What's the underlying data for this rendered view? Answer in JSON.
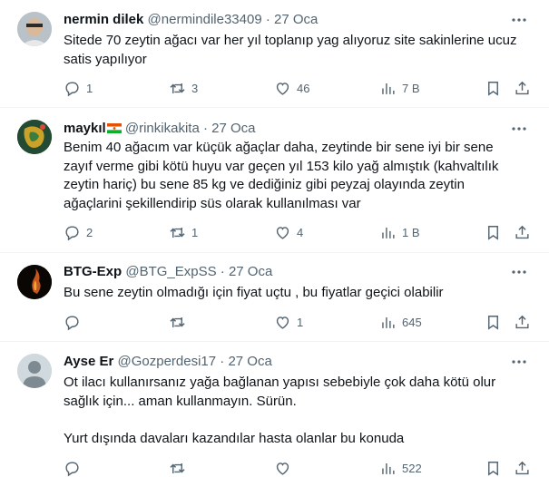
{
  "tweets": [
    {
      "name": "nermin dilek",
      "handle": "@nermindile33409",
      "separator": "·",
      "date": "27 Oca",
      "text": "Sitede 70 zeytin ağacı var her yıl toplanıp yag alıyoruz site sakinlerine ucuz\nsatis yapılıyor",
      "replies": "1",
      "retweets": "3",
      "likes": "46",
      "views": "7 B"
    },
    {
      "name": "maykıl",
      "handle": "@rinkikakita",
      "separator": "·",
      "date": "27 Oca",
      "text": "Benim 40 ağacım var küçük ağaçlar daha, zeytinde bir sene iyi bir sene\nzayıf verme gibi kötü huyu var geçen yıl 153 kilo yağ almıştık (kahvaltılık\nzeytin hariç) bu sene 85 kg ve dediğiniz gibi peyzaj olayında zeytin\nağaçlarini şekillendirip süs olarak kullanılması var",
      "replies": "2",
      "retweets": "1",
      "likes": "4",
      "views": "1 B"
    },
    {
      "name": "BTG-Exp",
      "handle": "@BTG_ExpSS",
      "separator": "·",
      "date": "27 Oca",
      "text": "Bu sene zeytin olmadığı için fiyat uçtu , bu fiyatlar geçici olabilir",
      "replies": "",
      "retweets": "",
      "likes": "1",
      "views": "645"
    },
    {
      "name": "Ayse Er",
      "handle": "@Gozperdesi17",
      "separator": "·",
      "date": "27 Oca",
      "text": "Ot ilacı kullanırsanız yağa bağlanan yapısı sebebiyle çok daha kötü olur\nsağlık için... aman kullanmayın. Sürün.\n\nYurt dışında davaları kazandılar hasta olanlar bu konuda",
      "replies": "",
      "retweets": "",
      "likes": "",
      "views": "522"
    }
  ],
  "icons": {
    "more": "more-horizontal-icon",
    "reply": "reply-icon",
    "retweet": "retweet-icon",
    "like": "heart-icon",
    "views": "views-icon",
    "bookmark": "bookmark-icon",
    "share": "share-icon",
    "flag": "niger-flag-icon"
  },
  "colors": {
    "text": "#0f1419",
    "secondary": "#536471",
    "divider": "#eff3f4"
  }
}
